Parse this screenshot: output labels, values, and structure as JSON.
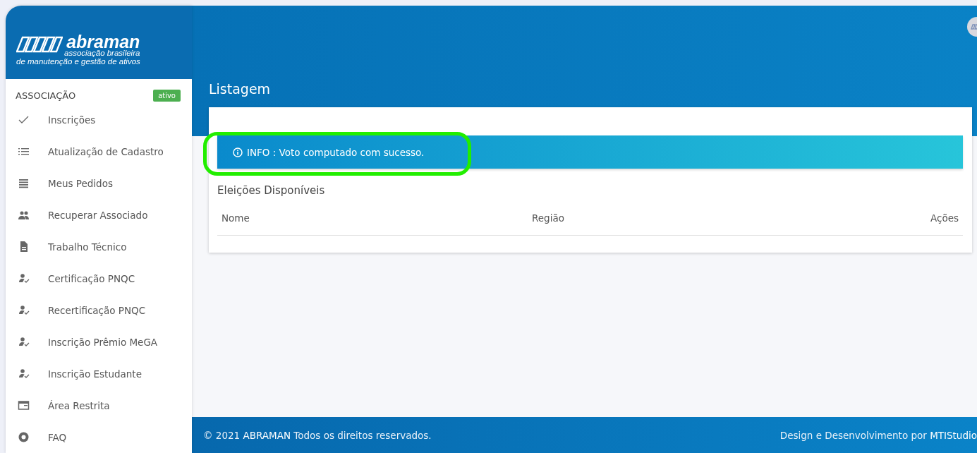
{
  "sidebar": {
    "logo": {
      "name": "abraman",
      "tagline_1": "associação brasileira",
      "tagline_2": "de manutenção e gestão de ativos"
    },
    "section": {
      "title": "ASSOCIAÇÃO",
      "badge": "ativo"
    },
    "items": [
      {
        "label": "Inscrições",
        "kind": "check"
      },
      {
        "label": "Atualização de Cadastro",
        "kind": "list"
      },
      {
        "label": "Meus Pedidos",
        "kind": "lines"
      },
      {
        "label": "Recuperar Associado",
        "kind": "people"
      },
      {
        "label": "Trabalho Técnico",
        "kind": "document"
      },
      {
        "label": "Certificação PNQC",
        "kind": "person-check"
      },
      {
        "label": "Recertificação PNQC",
        "kind": "person-check"
      },
      {
        "label": "Inscrição Prêmio MeGA",
        "kind": "person-check"
      },
      {
        "label": "Inscrição Estudante",
        "kind": "person-check"
      },
      {
        "label": "Área Restrita",
        "kind": "window"
      },
      {
        "label": "FAQ",
        "kind": "help"
      }
    ]
  },
  "page": {
    "title": "Listagem",
    "alert": {
      "text": "INFO : Voto computado com sucesso."
    },
    "section_title": "Eleições Disponíveis",
    "table": {
      "columns": [
        "Nome",
        "Região",
        "Ações"
      ]
    }
  },
  "footer": {
    "left": "© 2021 **ABRAMAN** Todos os direitos reservados.",
    "right": "Design e Desenvolvimento por **MTIStudio**"
  }
}
